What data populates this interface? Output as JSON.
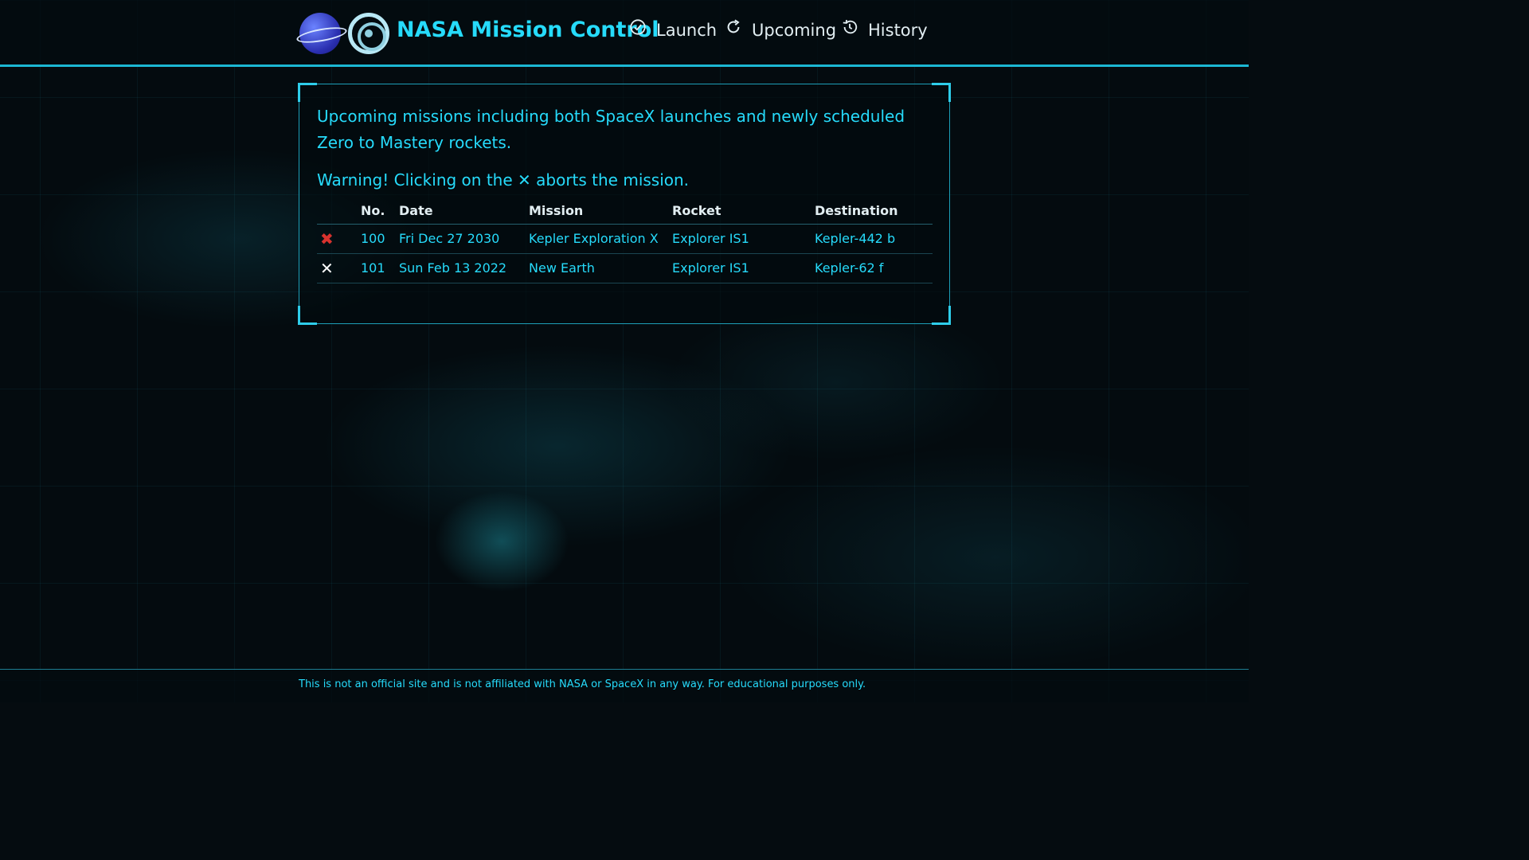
{
  "header": {
    "title": "NASA Mission Control",
    "nav": [
      {
        "label": "Launch",
        "icon": "check-circle-icon"
      },
      {
        "label": "Upcoming",
        "icon": "refresh-icon"
      },
      {
        "label": "History",
        "icon": "history-icon"
      }
    ]
  },
  "main": {
    "intro": "Upcoming missions including both SpaceX launches and newly scheduled Zero to Mastery rockets.",
    "warning_prefix": "Warning! Clicking on the",
    "warning_glyph": "✕",
    "warning_suffix": "aborts the mission.",
    "table": {
      "headers": [
        "",
        "No.",
        "Date",
        "Mission",
        "Rocket",
        "Destination"
      ],
      "rows": [
        {
          "abort": "✖",
          "abort_color": "#d8322e",
          "no": "100",
          "date": "Fri Dec 27 2030",
          "mission": "Kepler Exploration X",
          "rocket": "Explorer IS1",
          "destination": "Kepler-442 b"
        },
        {
          "abort": "✕",
          "abort_color": "#ffffff",
          "no": "101",
          "date": "Sun Feb 13 2022",
          "mission": "New Earth",
          "rocket": "Explorer IS1",
          "destination": "Kepler-62 f"
        }
      ]
    }
  },
  "footer": {
    "text": "This is not an official site and is not affiliated with NASA or SpaceX in any way. For educational purposes only."
  },
  "colors": {
    "accent": "#26dbfb",
    "nav_text": "#e2eef2",
    "abort_red": "#d8322e"
  }
}
